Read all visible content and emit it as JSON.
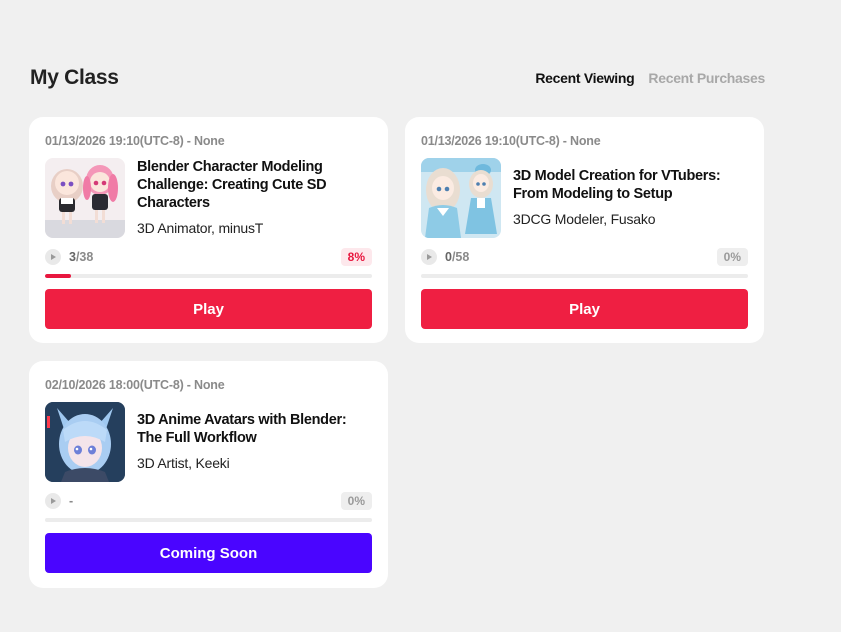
{
  "page_title": "My Class",
  "tabs": [
    {
      "label": "Recent Viewing",
      "active": true
    },
    {
      "label": "Recent Purchases",
      "active": false
    }
  ],
  "classes": [
    {
      "date": "01/13/2026 19:10(UTC-8) - None",
      "title": "Blender Character Modeling Challenge: Creating Cute SD Characters",
      "author": "3D Animator, minusT",
      "progress_current": "3",
      "progress_total": "/38",
      "percent": "8%",
      "progress": 0.08,
      "button": "Play"
    },
    {
      "date": "01/13/2026 19:10(UTC-8) - None",
      "title": "3D Model Creation for VTubers: From Modeling to Setup",
      "author": "3DCG Modeler, Fusako",
      "progress_current": "0",
      "progress_total": "/58",
      "percent": "0%",
      "progress": 0,
      "button": "Play"
    },
    {
      "date": "02/10/2026 18:00(UTC-8) - None",
      "title": "3D Anime Avatars with Blender: The Full Workflow",
      "author": "3D Artist, Keeki",
      "progress_current": "-",
      "progress_total": "",
      "percent": "0%",
      "progress": 0,
      "button": "Coming Soon"
    }
  ],
  "colors": {
    "accent_red": "#ef1f42",
    "accent_purple": "#4a05ff",
    "background": "#f0f0f0"
  }
}
